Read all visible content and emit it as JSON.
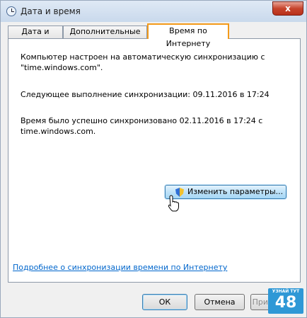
{
  "window": {
    "title": "Дата и время",
    "close_glyph": "x"
  },
  "tabs": [
    {
      "label": "Дата и время",
      "active": false
    },
    {
      "label": "Дополнительные часы",
      "active": false
    },
    {
      "label": "Время по Интернету",
      "active": true
    }
  ],
  "panel": {
    "line1": "Компьютер настроен на автоматическую синхронизацию с",
    "line2": "\"time.windows.com\".",
    "next_sync": "Следующее выполнение синхронизации: 09.11.2016 в 17:24",
    "last_sync_line1": "Время было успешно синхронизовано 02.11.2016 в 17:24 с",
    "last_sync_line2": "time.windows.com.",
    "change_button": "Изменить параметры...",
    "help_link": "Подробнее о синхронизации времени по Интернету"
  },
  "buttons": {
    "ok": "ОК",
    "cancel": "Отмена",
    "apply": "Применить"
  },
  "watermark": {
    "top": "УЗНАЙ ТУТ",
    "number": "48"
  },
  "colors": {
    "active_tab_border": "#f39a1a",
    "link": "#0066cc",
    "accent": "#3c7fb1"
  }
}
